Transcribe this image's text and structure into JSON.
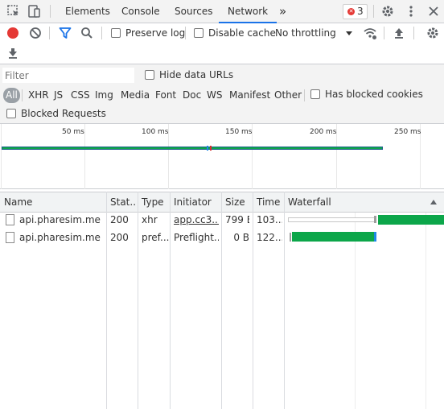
{
  "tabs": [
    {
      "label": "Elements"
    },
    {
      "label": "Console"
    },
    {
      "label": "Sources"
    },
    {
      "label": "Network"
    }
  ],
  "tabbar": {
    "more_glyph": "»",
    "error_count": "3"
  },
  "toolbar": {
    "preserve_log": "Preserve log",
    "disable_cache": "Disable cache",
    "throttling": "No throttling"
  },
  "filter": {
    "placeholder": "Filter",
    "hide_data_urls": "Hide data URLs",
    "types": [
      "All",
      "XHR",
      "JS",
      "CSS",
      "Img",
      "Media",
      "Font",
      "Doc",
      "WS",
      "Manifest",
      "Other"
    ],
    "has_blocked_cookies": "Has blocked cookies",
    "blocked_requests": "Blocked Requests"
  },
  "overview": {
    "ticks": [
      "50 ms",
      "100 ms",
      "150 ms",
      "200 ms",
      "250 ms"
    ]
  },
  "table": {
    "headers": [
      "Name",
      "Stat...",
      "Type",
      "Initiator",
      "Size",
      "Time",
      "Waterfall"
    ],
    "rows": [
      {
        "name": "api.pharesim.me",
        "status": "200",
        "type": "xhr",
        "initiator": "app.cc3...",
        "size": "799 B",
        "time": "103..."
      },
      {
        "name": "api.pharesim.me",
        "status": "200",
        "type": "pref...",
        "initiator": "Preflight...",
        "size": "0 B",
        "time": "122..."
      }
    ]
  },
  "colors": {
    "accent": "#1a73e8",
    "record": "#e53935",
    "waterfall_green": "#0ca64a",
    "waterfall_blue": "#1e88e5"
  },
  "icons": [
    "inspect-icon",
    "device-toolbar-icon",
    "more-tabs-icon",
    "error-icon",
    "settings-icon",
    "kebab-menu-icon",
    "record-icon",
    "clear-icon",
    "filter-icon",
    "search-icon",
    "dropdown-icon",
    "network-conditions-icon",
    "upload-icon",
    "download-icon",
    "sort-ascending-icon",
    "document-icon"
  ]
}
